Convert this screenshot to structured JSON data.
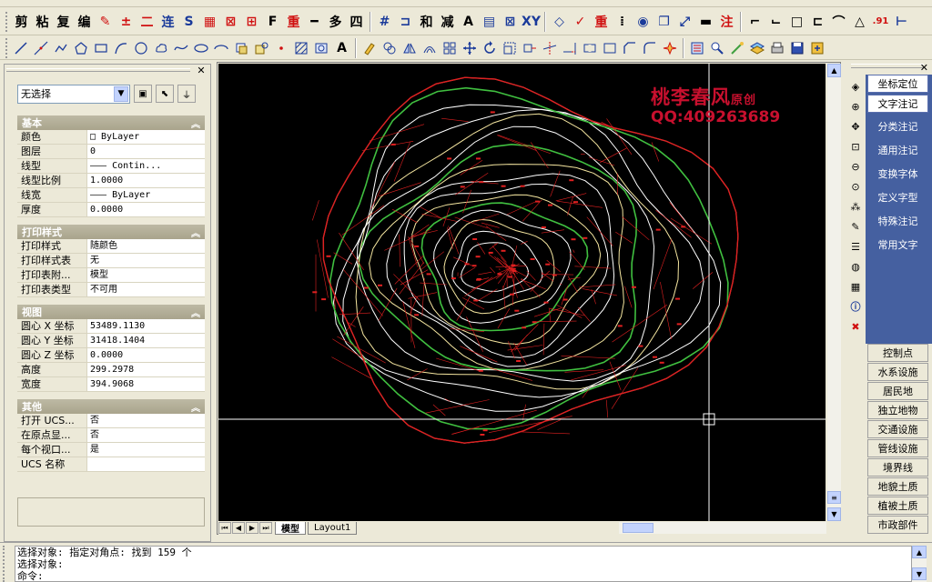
{
  "toolbar1": {
    "labels": [
      "剪",
      "粘",
      "复",
      "编",
      "重",
      "多",
      "四",
      "和",
      "减",
      "A",
      "XY",
      "注",
      ".91"
    ]
  },
  "toolbar2": {
    "text_tool": "A"
  },
  "properties": {
    "selection": "无选择",
    "groups": [
      {
        "title": "基本",
        "rows": [
          {
            "key": "颜色",
            "value": "□ ByLayer"
          },
          {
            "key": "图层",
            "value": "0"
          },
          {
            "key": "线型",
            "value": "——— Contin..."
          },
          {
            "key": "线型比例",
            "value": "1.0000"
          },
          {
            "key": "线宽",
            "value": "——— ByLayer"
          },
          {
            "key": "厚度",
            "value": "0.0000"
          }
        ]
      },
      {
        "title": "打印样式",
        "rows": [
          {
            "key": "打印样式",
            "value": "随颜色"
          },
          {
            "key": "打印样式表",
            "value": "无"
          },
          {
            "key": "打印表附...",
            "value": "模型"
          },
          {
            "key": "打印表类型",
            "value": "不可用"
          }
        ]
      },
      {
        "title": "视图",
        "rows": [
          {
            "key": "圆心 X 坐标",
            "value": "53489.1130"
          },
          {
            "key": "圆心 Y 坐标",
            "value": "31418.1404"
          },
          {
            "key": "圆心 Z 坐标",
            "value": "0.0000"
          },
          {
            "key": "高度",
            "value": "299.2978"
          },
          {
            "key": "宽度",
            "value": "394.9068"
          }
        ]
      },
      {
        "title": "其他",
        "rows": [
          {
            "key": "打开 UCS...",
            "value": "否"
          },
          {
            "key": "在原点显...",
            "value": "否"
          },
          {
            "key": "每个视口...",
            "value": "是"
          },
          {
            "key": "UCS 名称",
            "value": ""
          }
        ]
      }
    ]
  },
  "watermark": {
    "title": "桃李春风",
    "badge": "原创",
    "qq": "QQ:409263689"
  },
  "layout_tabs": {
    "model": "模型",
    "layout1": "Layout1"
  },
  "right_panel": {
    "top_buttons": [
      "坐标定位",
      "文字注记"
    ],
    "menu": [
      "分类注记",
      "通用注记",
      "变换字体",
      "定义字型",
      "特殊注记",
      "常用文字"
    ],
    "categories": [
      "控制点",
      "水系设施",
      "居民地",
      "独立地物",
      "交通设施",
      "管线设施",
      "境界线",
      "地貌土质",
      "植被土质",
      "市政部件"
    ]
  },
  "command_line": {
    "lines": [
      "选择对象: 指定对角点: 找到 159 个",
      "选择对象:",
      "命令:"
    ]
  },
  "colors": {
    "contour_major": "#f5e6a0",
    "contour_minor": "#ffffff",
    "contour_index": "#40c040",
    "tin": "#e02020",
    "accent_red": "#c8102e",
    "panel_blue": "#4560a0"
  }
}
